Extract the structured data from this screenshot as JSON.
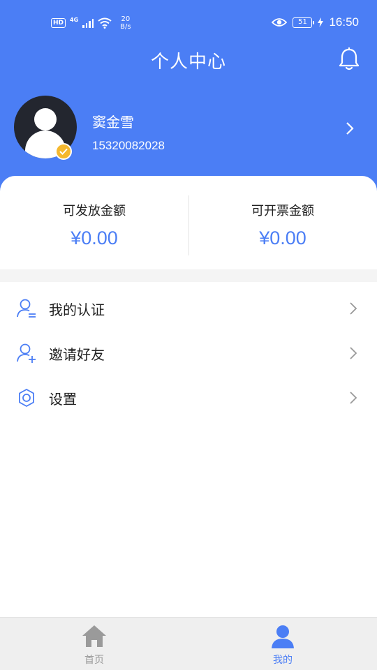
{
  "status_bar": {
    "hd": "HD",
    "network": "4G",
    "speed_value": "20",
    "speed_unit": "B/s",
    "battery": "51",
    "time": "16:50"
  },
  "header": {
    "title": "个人中心",
    "bell_icon": "bell-icon"
  },
  "profile": {
    "name": "窦金雪",
    "phone": "15320082028",
    "verified": true
  },
  "amounts": [
    {
      "label": "可发放金额",
      "value": "¥0.00"
    },
    {
      "label": "可开票金额",
      "value": "¥0.00"
    }
  ],
  "menu": [
    {
      "label": "我的认证",
      "icon": "user-verify-icon"
    },
    {
      "label": "邀请好友",
      "icon": "user-add-icon"
    },
    {
      "label": "设置",
      "icon": "gear-icon"
    }
  ],
  "tabbar": {
    "items": [
      {
        "label": "首页",
        "icon": "home-icon",
        "active": false
      },
      {
        "label": "我的",
        "icon": "person-icon",
        "active": true
      }
    ]
  },
  "colors": {
    "primary": "#4b7ef5",
    "badge": "#f5b82e",
    "avatar_bg": "#23262f",
    "tabbar_bg": "#efefef",
    "inactive": "#9a9a9a"
  }
}
